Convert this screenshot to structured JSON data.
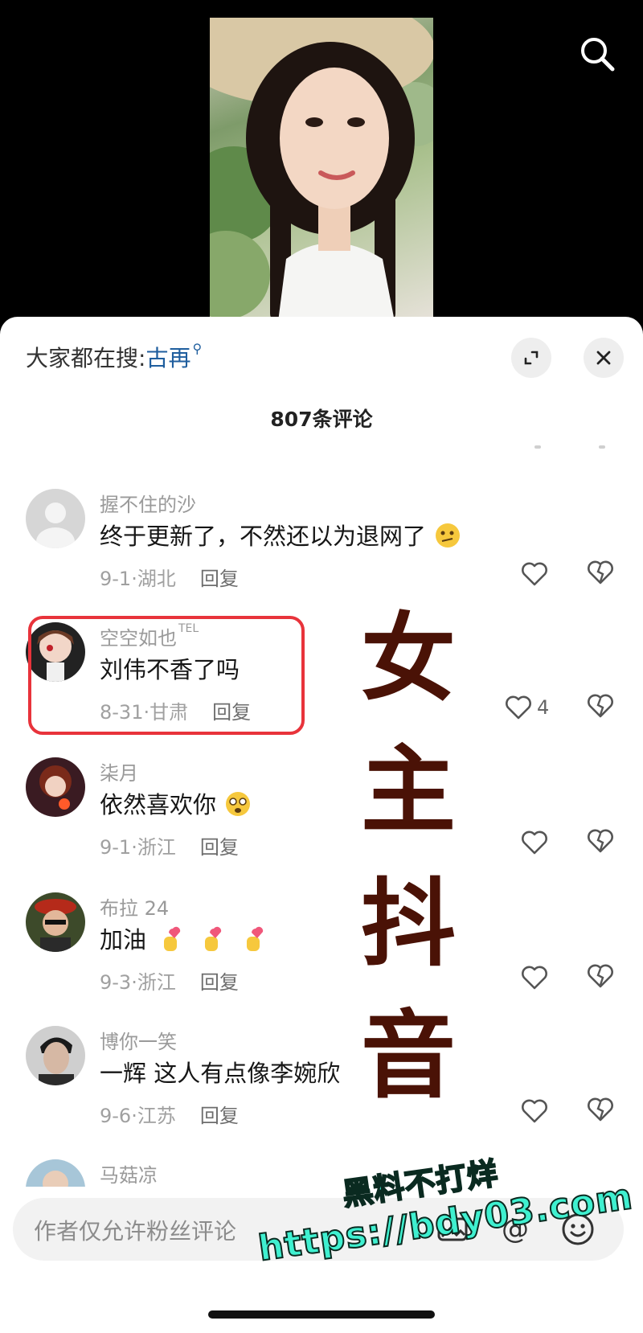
{
  "hot_search": {
    "prefix": "大家都在搜:",
    "keyword": "古再",
    "icon": "search-icon"
  },
  "comment_count": "807条评论",
  "comments": [
    {
      "username": "握不住的沙",
      "text": "终于更新了，不然还以为退网了",
      "emoji": "thinking-emoji",
      "date": "9-1",
      "location": "湖北",
      "reply": "回复",
      "likes": ""
    },
    {
      "username": "空空如也",
      "badge": "TEL",
      "text": "刘伟不香了吗",
      "date": "8-31",
      "location": "甘肃",
      "reply": "回复",
      "likes": "4"
    },
    {
      "username": "柒月",
      "text": "依然喜欢你",
      "emoji": "shy-emoji",
      "date": "9-1",
      "location": "浙江",
      "reply": "回复",
      "likes": ""
    },
    {
      "username": "布拉 24",
      "text": "加油",
      "emoji": "finger-heart-emoji x3",
      "date": "9-3",
      "location": "浙江",
      "reply": "回复",
      "likes": ""
    },
    {
      "username": "博你一笑",
      "text": "一辉  这人有点像李婉欣",
      "date": "9-6",
      "location": "江苏",
      "reply": "回复",
      "likes": ""
    },
    {
      "username": "马菇凉"
    }
  ],
  "overlay_vertical_text": [
    "女",
    "主",
    "抖",
    "音"
  ],
  "watermark": {
    "line1": "黑料不打烊",
    "line2": "https://bdy03.com"
  },
  "input": {
    "placeholder": "作者仅允许粉丝评论"
  },
  "colors": {
    "accent_link": "#1f5e9e",
    "highlight_border": "#e8333b",
    "overlay_text": "#4a1206",
    "watermark": "#3ff0d0"
  }
}
